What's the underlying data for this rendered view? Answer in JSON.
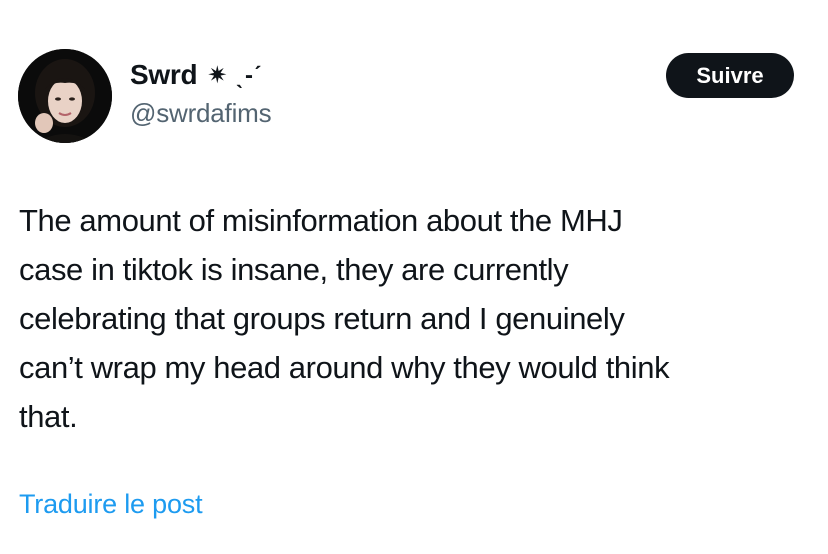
{
  "author": {
    "display_name": "Swrd",
    "name_decoration": "✷ ˎ-ˊ",
    "handle": "@swrdafims"
  },
  "actions": {
    "follow_label": "Suivre"
  },
  "post": {
    "text": "The amount of misinformation about the MHJ\ncase in tiktok is insane, they are currently\ncelebrating that groups return and I genuinely\ncan’t wrap my head around why they would think\nthat.",
    "translate_label": "Traduire le post"
  },
  "colors": {
    "text_primary": "#0f1419",
    "text_secondary": "#536471",
    "link": "#1d9bf0",
    "button_bg": "#0f1419",
    "button_text": "#ffffff"
  }
}
